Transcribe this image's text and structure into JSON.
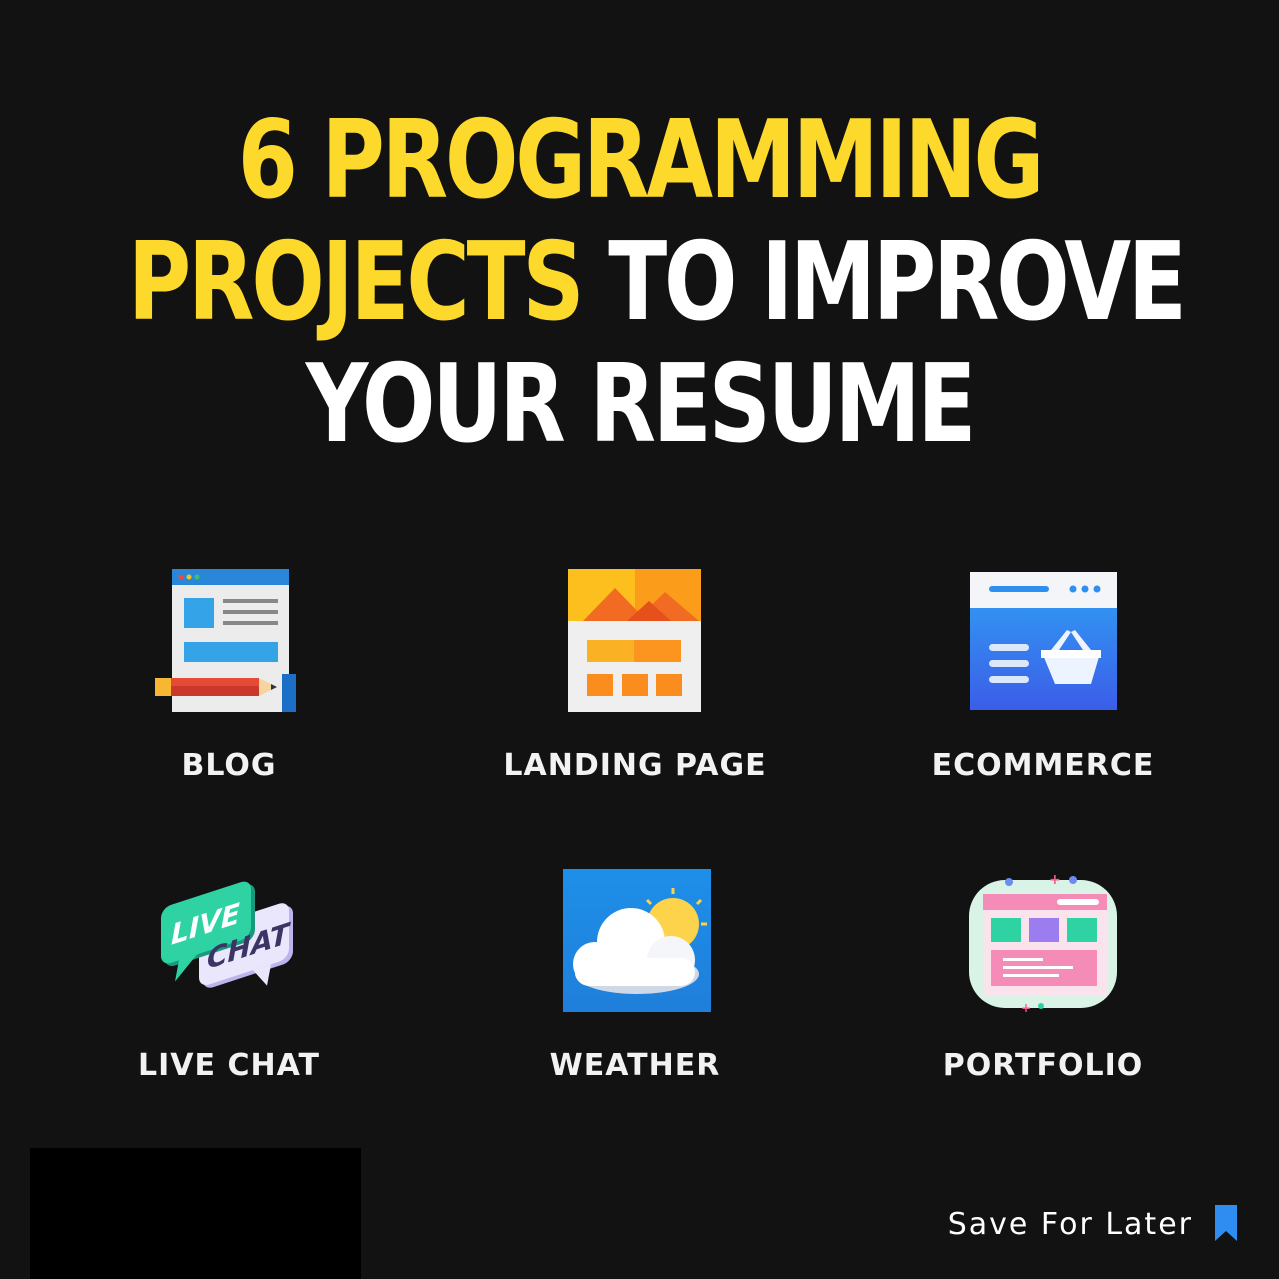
{
  "headline": {
    "line1": "6 PROGRAMMING",
    "line2_yellow": "PROJECTS",
    "line2_white": "TO IMPROVE",
    "line3": "YOUR RESUME"
  },
  "projects": [
    {
      "label": "BLOG",
      "icon": "blog-icon"
    },
    {
      "label": "LANDING PAGE",
      "icon": "landing-page-icon"
    },
    {
      "label": "ECOMMERCE",
      "icon": "ecommerce-icon"
    },
    {
      "label": "LIVE CHAT",
      "icon": "live-chat-icon"
    },
    {
      "label": "WEATHER",
      "icon": "weather-icon"
    },
    {
      "label": "PORTFOLIO",
      "icon": "portfolio-icon"
    }
  ],
  "live_chat_icon_text": {
    "top": "LIVE",
    "bottom": "CHAT"
  },
  "footer": {
    "save_label": "Save For Later",
    "icon": "bookmark-icon"
  },
  "colors": {
    "background": "#121212",
    "accent_yellow": "#fcd92a",
    "text_white": "#ffffff",
    "bookmark_blue": "#2f8cf0"
  }
}
